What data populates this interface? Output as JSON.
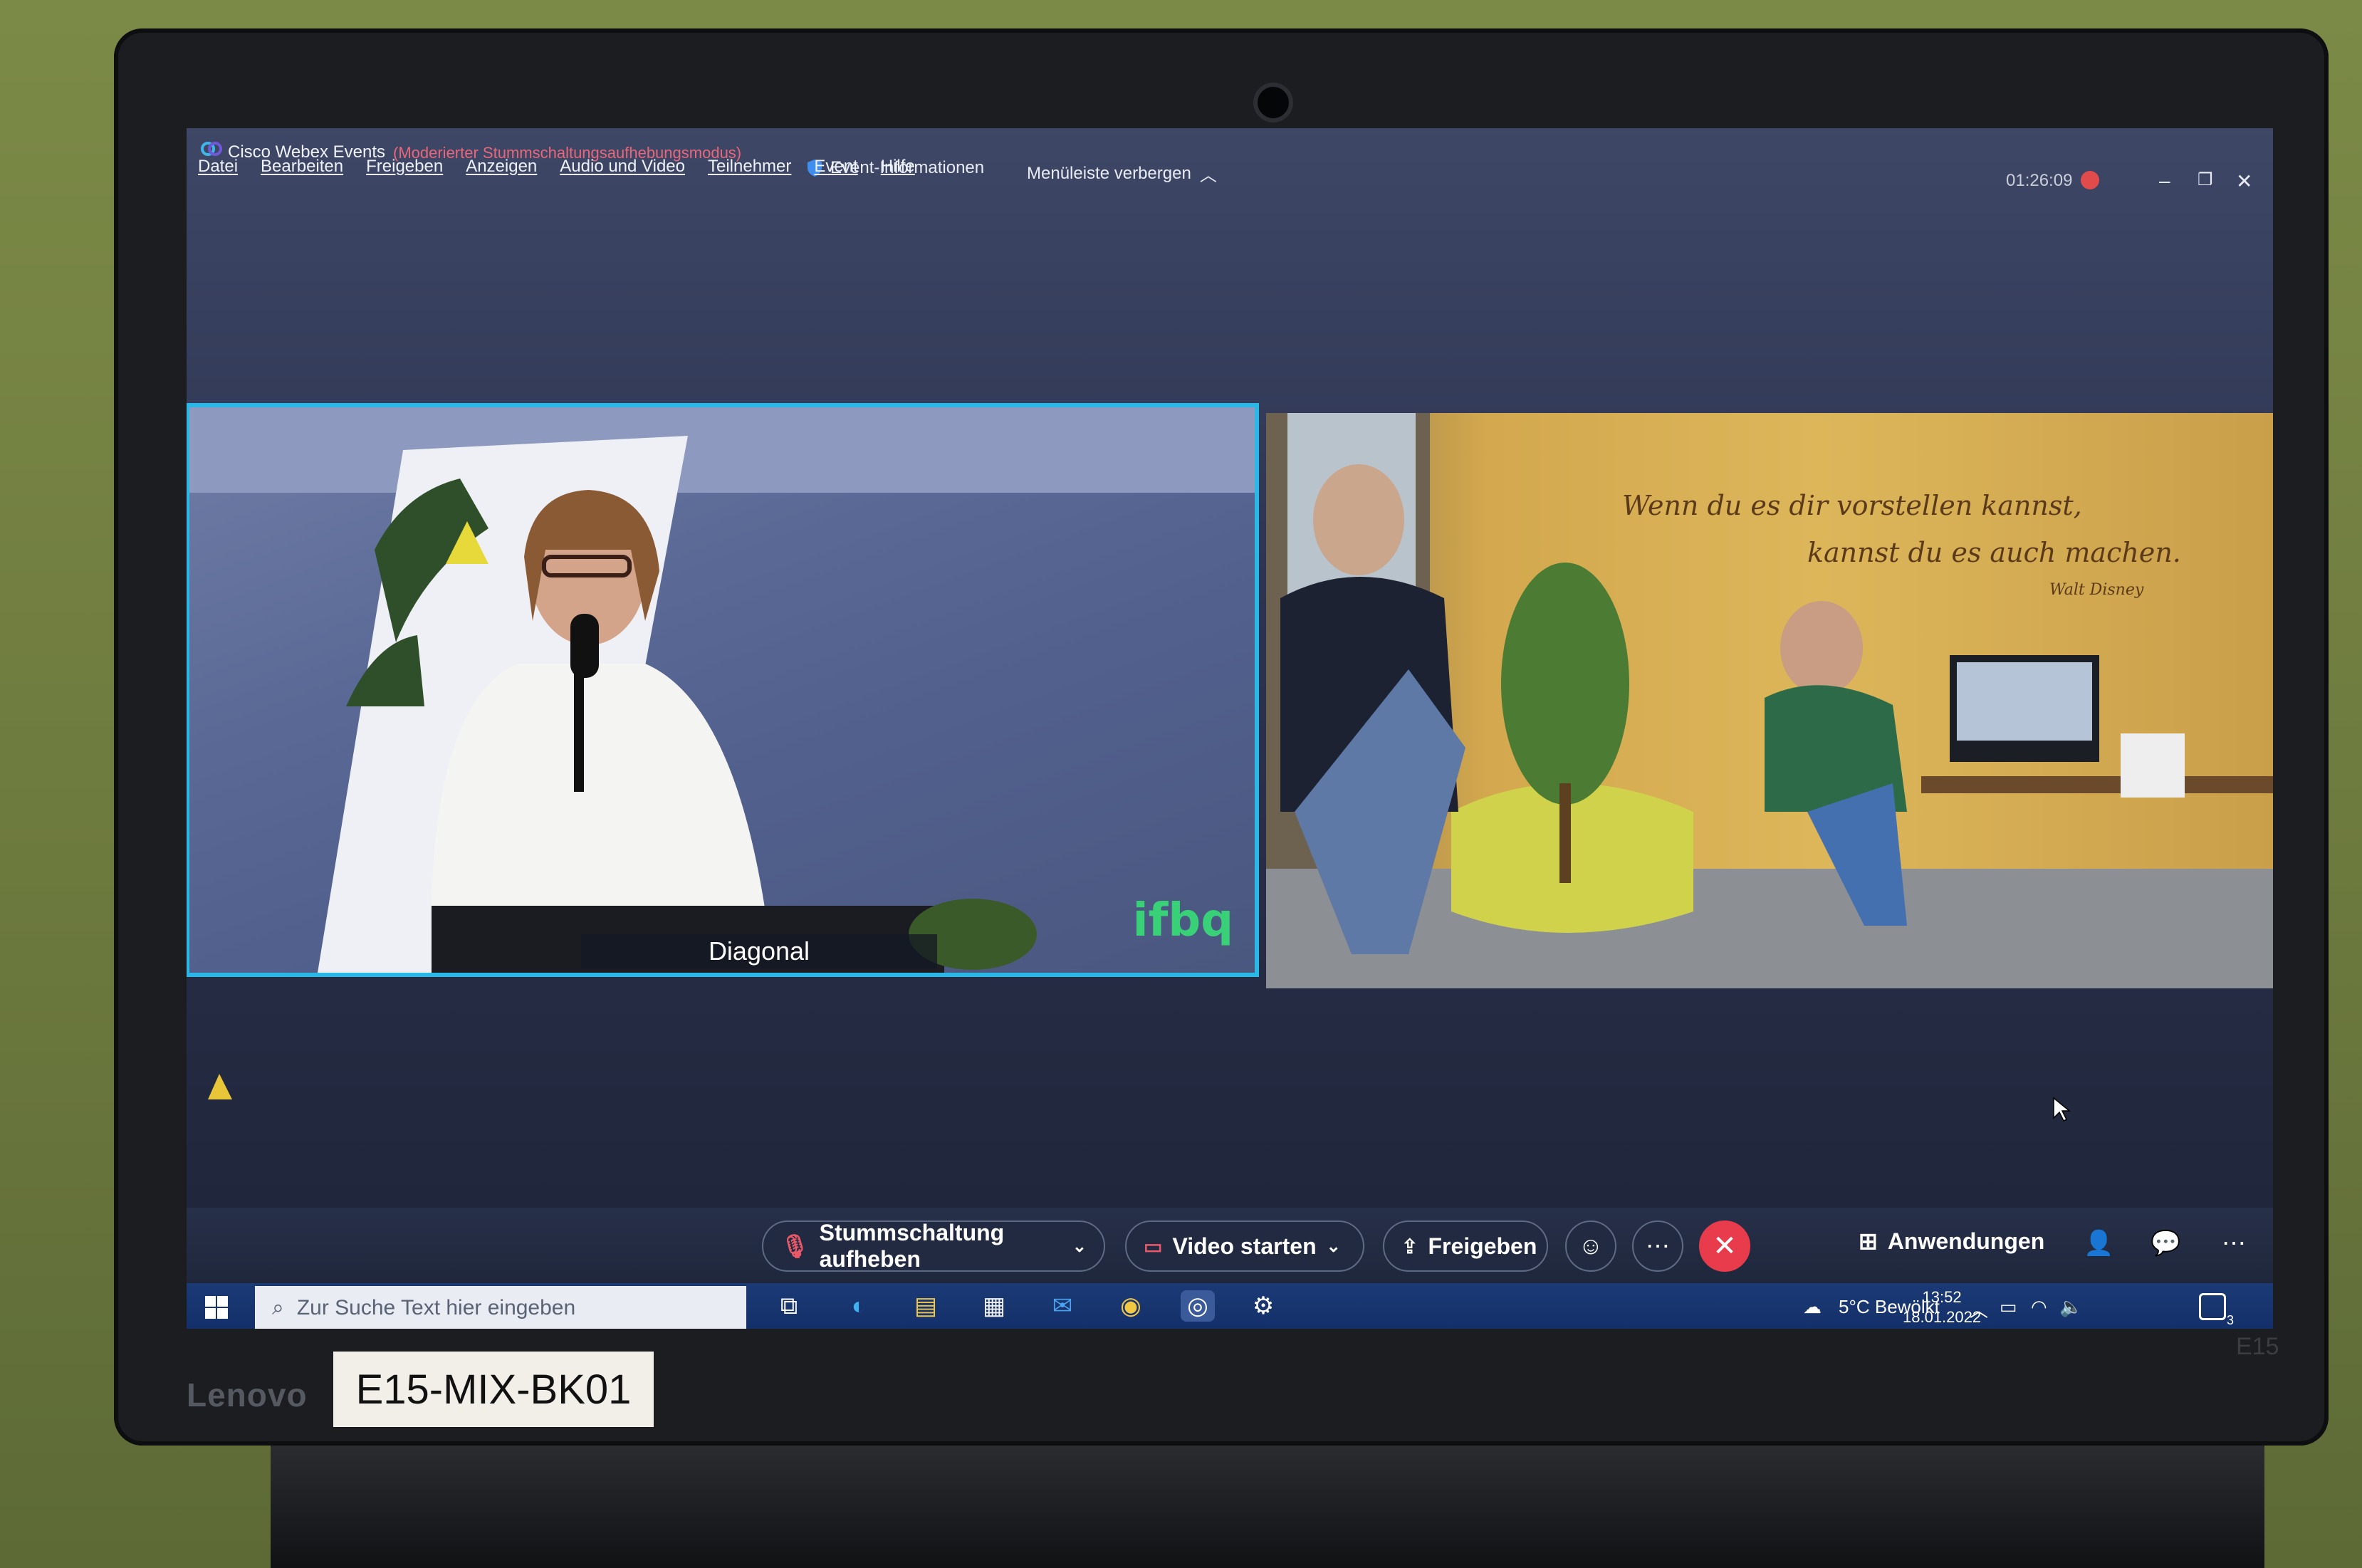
{
  "window": {
    "app_title": "Cisco Webex Events",
    "mode": "(Moderierter Stummschaltungsaufhebungsmodus)",
    "event_info": "Event-Informationen",
    "hide_menu": "Menüleiste verbergen",
    "timer": "01:26:09"
  },
  "menu": [
    "Datei",
    "Bearbeiten",
    "Freigeben",
    "Anzeigen",
    "Audio und Video",
    "Teilnehmer",
    "Event",
    "Hilfe"
  ],
  "videos": {
    "left": {
      "name_label": "Diagonal",
      "brand_mark": "ifbq"
    },
    "right": {
      "quote_line1": "Wenn du es dir vorstellen kannst,",
      "quote_line2": "kannst du es auch machen.",
      "quote_author": "Walt Disney"
    }
  },
  "controls": {
    "unmute": "Stummschaltung aufheben",
    "start_video": "Video starten",
    "share": "Freigeben",
    "apps": "Anwendungen"
  },
  "taskbar": {
    "search_placeholder": "Zur Suche Text hier eingeben",
    "weather": "5°C Bewölkt",
    "time": "13:52",
    "date": "18.01.2022",
    "notifications": "3"
  },
  "device": {
    "brand": "Lenovo",
    "sticker": "E15-MIX-BK01",
    "model": "E15"
  },
  "colors": {
    "accent_border": "#2bb8e6",
    "end_call": "#e83c4c",
    "recording": "#e24b4b"
  }
}
